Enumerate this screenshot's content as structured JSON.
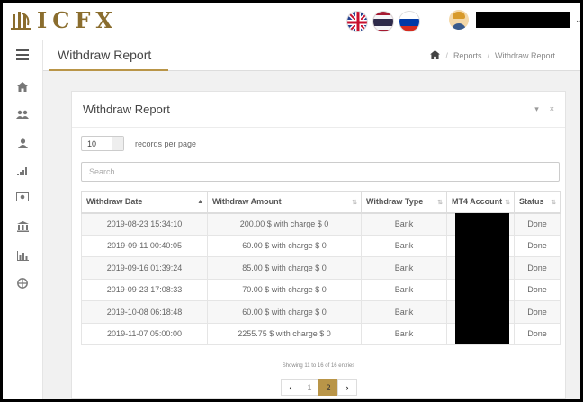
{
  "brand": {
    "name": "ICFX",
    "color": "#8a6d2e"
  },
  "top": {
    "languages": [
      {
        "name": "uk-flag-icon"
      },
      {
        "name": "thai-flag-icon"
      },
      {
        "name": "russia-flag-icon"
      }
    ],
    "user_menu_caret": "⌄"
  },
  "sidebar": {
    "items": [
      {
        "icon": "menu-icon"
      },
      {
        "icon": "home-icon"
      },
      {
        "icon": "users-icon"
      },
      {
        "icon": "user-icon"
      },
      {
        "icon": "signal-icon"
      },
      {
        "icon": "money-icon"
      },
      {
        "icon": "bank-icon"
      },
      {
        "icon": "bar-chart-icon"
      },
      {
        "icon": "globe-icon"
      }
    ]
  },
  "header": {
    "title": "Withdraw Report",
    "breadcrumb": {
      "home_icon": "home-icon",
      "items": [
        "Reports",
        "Withdraw Report"
      ],
      "separator": "/"
    }
  },
  "panel": {
    "title": "Withdraw Report",
    "tools": {
      "collapse": "▾",
      "close": "×"
    },
    "length": {
      "value": "10",
      "label": "records per page"
    },
    "search": {
      "placeholder": "Search"
    },
    "table": {
      "columns": [
        "Withdraw Date",
        "Withdraw Amount",
        "Withdraw Type",
        "MT4 Account",
        "Status"
      ],
      "rows": [
        {
          "date": "2019-08-23 15:34:10",
          "amount": "200.00 $ with charge $ 0",
          "type": "Bank",
          "account": "",
          "status": "Done"
        },
        {
          "date": "2019-09-11 00:40:05",
          "amount": "60.00 $ with charge $ 0",
          "type": "Bank",
          "account": "",
          "status": "Done"
        },
        {
          "date": "2019-09-16 01:39:24",
          "amount": "85.00 $ with charge $ 0",
          "type": "Bank",
          "account": "",
          "status": "Done"
        },
        {
          "date": "2019-09-23 17:08:33",
          "amount": "70.00 $ with charge $ 0",
          "type": "Bank",
          "account": "",
          "status": "Done"
        },
        {
          "date": "2019-10-08 06:18:48",
          "amount": "60.00 $ with charge $ 0",
          "type": "Bank",
          "account": "",
          "status": "Done"
        },
        {
          "date": "2019-11-07 05:00:00",
          "amount": "2255.75 $ with charge $ 0",
          "type": "Bank",
          "account": "",
          "status": "Done"
        }
      ]
    },
    "info": "Showing 11 to 16 of 16 entries",
    "pagination": {
      "prev": "‹",
      "pages": [
        "1",
        "2"
      ],
      "active": "2",
      "next": "›"
    }
  },
  "colors": {
    "accent": "#b99548",
    "background": "#f1f1f1"
  }
}
